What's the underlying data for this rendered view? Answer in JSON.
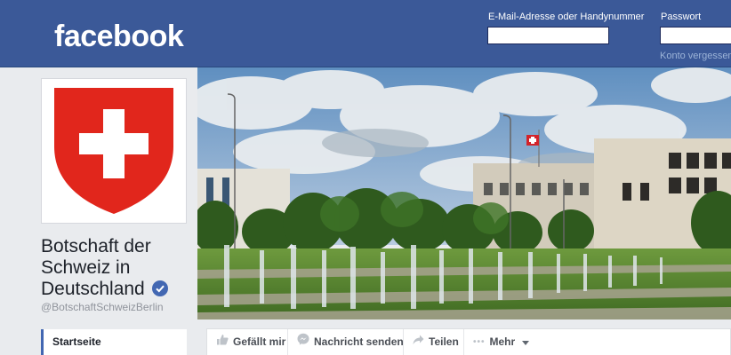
{
  "header": {
    "logo": "facebook",
    "email_label": "E-Mail-Adresse oder Handynummer",
    "password_label": "Passwort",
    "email_value": "",
    "password_value": "",
    "forgot_link": "Konto vergessen?",
    "bg_color": "#3b5998"
  },
  "page": {
    "name": "Botschaft der Schweiz in Deutschland",
    "name_lines": [
      "Botschaft der",
      "Schweiz in",
      "Deutschland"
    ],
    "handle": "@BotschaftSchweizBerlin",
    "verified": true,
    "profile_icon": "swiss-coat-of-arms"
  },
  "sidebar": {
    "items": [
      {
        "label": "Startseite",
        "active": true
      }
    ]
  },
  "actions": {
    "like": {
      "label": "Gefällt mir",
      "icon": "thumbs-up-icon"
    },
    "message": {
      "label": "Nachricht senden",
      "icon": "messenger-icon"
    },
    "share": {
      "label": "Teilen",
      "icon": "share-arrow-icon"
    },
    "more": {
      "label": "Mehr",
      "icon": "more-dots-icon"
    }
  },
  "colors": {
    "brand_blue": "#3b5998",
    "swiss_red": "#e1261c",
    "accent": "#4267b2"
  }
}
